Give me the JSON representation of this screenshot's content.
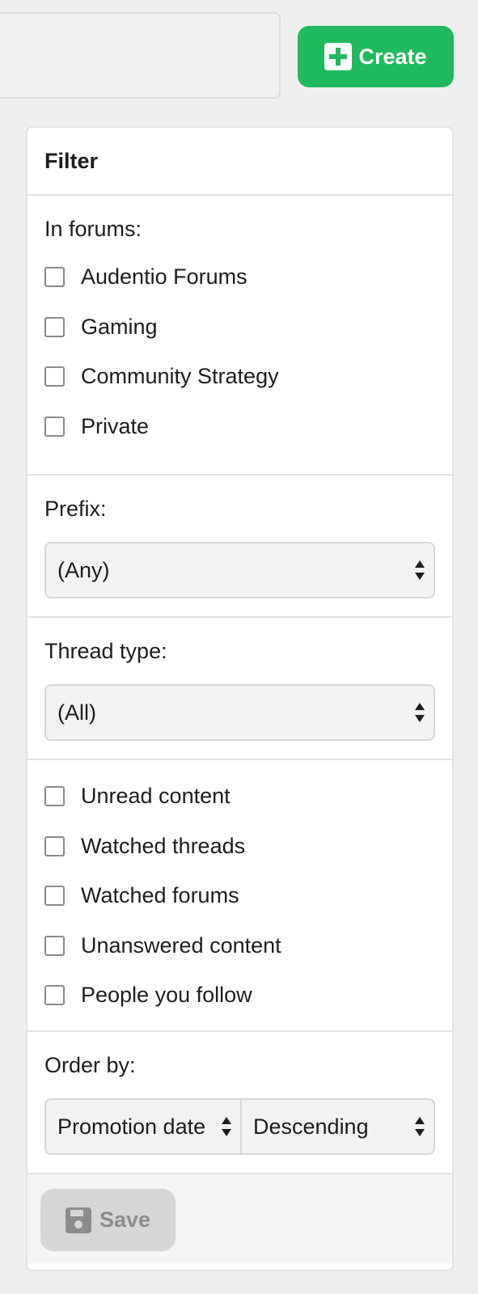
{
  "header": {
    "create_label": "Create"
  },
  "filter": {
    "title": "Filter",
    "forums": {
      "label": "In forums:",
      "items": [
        "Audentio Forums",
        "Gaming",
        "Community Strategy",
        "Private"
      ]
    },
    "prefix": {
      "label": "Prefix:",
      "selected": "(Any)"
    },
    "thread_type": {
      "label": "Thread type:",
      "selected": "(All)"
    },
    "options": [
      "Unread content",
      "Watched threads",
      "Watched forums",
      "Unanswered content",
      "People you follow"
    ],
    "order": {
      "label": "Order by:",
      "field": "Promotion date",
      "direction": "Descending"
    },
    "save_label": "Save"
  },
  "colors": {
    "accent_green": "#1fba5d",
    "disabled_gray": "#d6d6d6"
  },
  "icons": [
    "plus-icon",
    "checkbox-icon",
    "updown-icon",
    "save-icon"
  ]
}
